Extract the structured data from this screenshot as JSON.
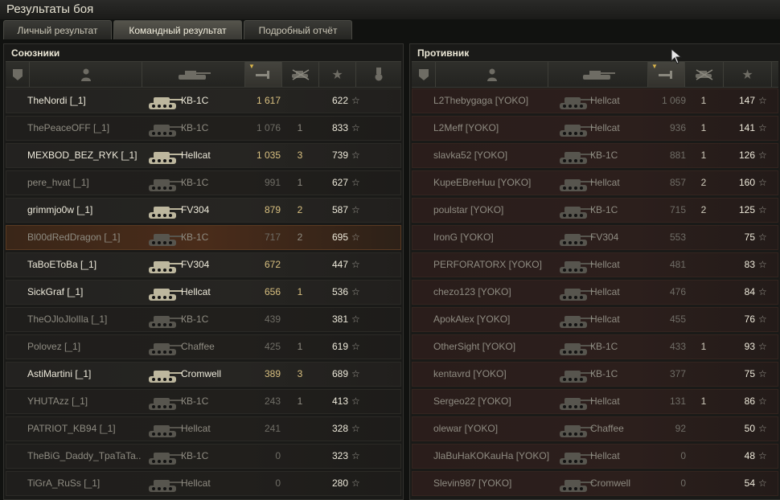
{
  "window": {
    "title": "Результаты боя"
  },
  "tabs": [
    {
      "label": "Личный результат",
      "active": false
    },
    {
      "label": "Командный результат",
      "active": true
    },
    {
      "label": "Подробный отчёт",
      "active": false
    }
  ],
  "allies": {
    "title": "Союзники",
    "header_icons": [
      "rank-icon",
      "player-icon",
      "tank-icon",
      "damage-icon",
      "kills-icon",
      "xp-star-icon",
      "medal-icon"
    ],
    "rows": [
      {
        "name": "TheNordi [_1]",
        "tank": "КВ-1С",
        "damage": "1 617",
        "kills": "",
        "xp": "622",
        "alive": true
      },
      {
        "name": "ThePeaceOFF [_1]",
        "tank": "КВ-1С",
        "damage": "1 076",
        "kills": "1",
        "xp": "833",
        "alive": false
      },
      {
        "name": "MEXBOD_BEZ_RYK [_1]",
        "tank": "Hellcat",
        "damage": "1 035",
        "kills": "3",
        "xp": "739",
        "alive": true
      },
      {
        "name": "pere_hvat [_1]",
        "tank": "КВ-1С",
        "damage": "991",
        "kills": "1",
        "xp": "627",
        "alive": false
      },
      {
        "name": "grimmjo0w [_1]",
        "tank": "FV304",
        "damage": "879",
        "kills": "2",
        "xp": "587",
        "alive": true
      },
      {
        "name": "Bl00dRedDragon [_1]",
        "tank": "КВ-1С",
        "damage": "717",
        "kills": "2",
        "xp": "695",
        "alive": false,
        "highlight": true
      },
      {
        "name": "TaBoEToBa [_1]",
        "tank": "FV304",
        "damage": "672",
        "kills": "",
        "xp": "447",
        "alive": true
      },
      {
        "name": "SickGraf [_1]",
        "tank": "Hellcat",
        "damage": "656",
        "kills": "1",
        "xp": "536",
        "alive": true
      },
      {
        "name": "TheOJloJlolIla [_1]",
        "tank": "КВ-1С",
        "damage": "439",
        "kills": "",
        "xp": "381",
        "alive": false
      },
      {
        "name": "Polovez [_1]",
        "tank": "Chaffee",
        "damage": "425",
        "kills": "1",
        "xp": "619",
        "alive": false
      },
      {
        "name": "AstiMartini [_1]",
        "tank": "Cromwell",
        "damage": "389",
        "kills": "3",
        "xp": "689",
        "alive": true
      },
      {
        "name": "YHUTAzz [_1]",
        "tank": "КВ-1С",
        "damage": "243",
        "kills": "1",
        "xp": "413",
        "alive": false
      },
      {
        "name": "PATRIOT_KB94 [_1]",
        "tank": "Hellcat",
        "damage": "241",
        "kills": "",
        "xp": "328",
        "alive": false
      },
      {
        "name": "TheBiG_Daddy_TpaTaTa..",
        "tank": "КВ-1С",
        "damage": "0",
        "kills": "",
        "xp": "323",
        "alive": false
      },
      {
        "name": "TiGrA_RuSs [_1]",
        "tank": "Hellcat",
        "damage": "0",
        "kills": "",
        "xp": "280",
        "alive": false
      }
    ]
  },
  "enemies": {
    "title": "Противник",
    "rows": [
      {
        "name": "L2Thebygaga [YOKO]",
        "tank": "Hellcat",
        "damage": "1 069",
        "kills": "1",
        "xp": "147"
      },
      {
        "name": "L2Meff [YOKO]",
        "tank": "Hellcat",
        "damage": "936",
        "kills": "1",
        "xp": "141"
      },
      {
        "name": "slavka52 [YOKO]",
        "tank": "КВ-1С",
        "damage": "881",
        "kills": "1",
        "xp": "126"
      },
      {
        "name": "KupeEBreHuu [YOKO]",
        "tank": "Hellcat",
        "damage": "857",
        "kills": "2",
        "xp": "160"
      },
      {
        "name": "poulstar [YOKO]",
        "tank": "КВ-1С",
        "damage": "715",
        "kills": "2",
        "xp": "125"
      },
      {
        "name": "IronG [YOKO]",
        "tank": "FV304",
        "damage": "553",
        "kills": "",
        "xp": "75"
      },
      {
        "name": "PERFORATORX [YOKO]",
        "tank": "Hellcat",
        "damage": "481",
        "kills": "",
        "xp": "83"
      },
      {
        "name": "chezo123 [YOKO]",
        "tank": "Hellcat",
        "damage": "476",
        "kills": "",
        "xp": "84"
      },
      {
        "name": "ApokAlex [YOKO]",
        "tank": "Hellcat",
        "damage": "455",
        "kills": "",
        "xp": "76"
      },
      {
        "name": "OtherSight [YOKO]",
        "tank": "КВ-1С",
        "damage": "433",
        "kills": "1",
        "xp": "93"
      },
      {
        "name": "kentavrd [YOKO]",
        "tank": "КВ-1С",
        "damage": "377",
        "kills": "",
        "xp": "75"
      },
      {
        "name": "Sergeo22 [YOKO]",
        "tank": "Hellcat",
        "damage": "131",
        "kills": "1",
        "xp": "86"
      },
      {
        "name": "olewar [YOKO]",
        "tank": "Chaffee",
        "damage": "92",
        "kills": "",
        "xp": "50"
      },
      {
        "name": "JlaBuHaKOKauHa [YOKO]",
        "tank": "Hellcat",
        "damage": "0",
        "kills": "",
        "xp": "48"
      },
      {
        "name": "Slevin987 [YOKO]",
        "tank": "Cromwell",
        "damage": "0",
        "kills": "",
        "xp": "54"
      }
    ]
  },
  "colors": {
    "accent": "#d9b54a",
    "ally_row": "#232220",
    "enemy_row": "#2a1d1b",
    "highlight_row": "#4a2c1a"
  }
}
